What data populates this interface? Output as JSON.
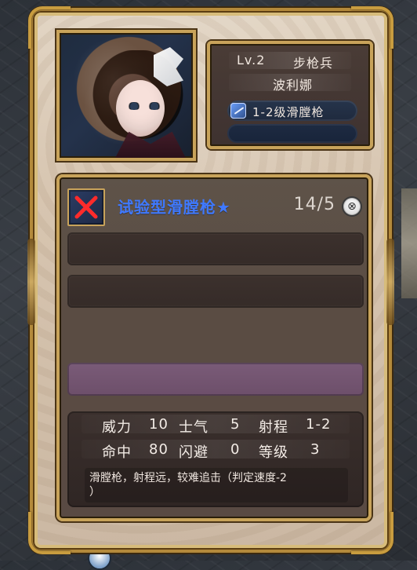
{
  "character": {
    "level": "Lv.2",
    "class": "步枪兵",
    "name": "波利娜",
    "weapon": "1-2级滑膛枪"
  },
  "equipment": {
    "name": "试验型滑膛枪★",
    "count": "14/5",
    "close_icon": "⊗",
    "stats": {
      "row1": {
        "label1": "威力",
        "value1": "10",
        "label2": "士气",
        "value2": "5",
        "label3": "射程",
        "value3": "1-2"
      },
      "row2": {
        "label1": "命中",
        "value1": "80",
        "label2": "闪避",
        "value2": "0",
        "label3": "等级",
        "value3": "3"
      }
    },
    "description": "滑膛枪，射程远，较难追击（判定速度-2\n）"
  },
  "icons": {
    "equip": "x-mark-icon",
    "weapon": "musket-icon",
    "close": "close-icon"
  },
  "colors": {
    "equip_name": "#3f79ff",
    "gold_frame": "#c8a35a",
    "purple_bar": "#7a5b78"
  }
}
